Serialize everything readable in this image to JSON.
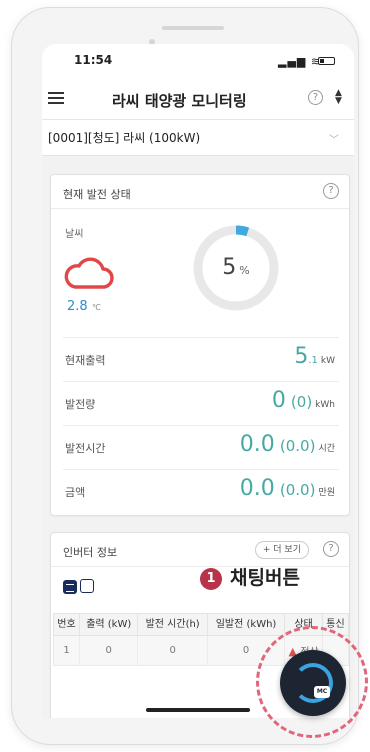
{
  "status_bar": {
    "time": "11:54"
  },
  "app": {
    "title": "라씨 태양광 모니터링",
    "help": "?",
    "sort_icon": "sort-icon"
  },
  "site_select": {
    "value": "[0001][청도] 라씨 (100kW)"
  },
  "current_status": {
    "title": "현재 발전 상태",
    "help": "?",
    "weather_label": "날씨",
    "weather_icon": "cloud-icon",
    "temperature": "2.8",
    "temperature_unit": "℃",
    "gauge_value": "5",
    "gauge_unit": "%",
    "gauge_fraction": 0.05,
    "rows": [
      {
        "label": "현재출력",
        "big": "5",
        "small": ".1",
        "paren": "",
        "unit": "kW"
      },
      {
        "label": "발전량",
        "big": "0",
        "small": "",
        "paren": "(0)",
        "unit": "kWh"
      },
      {
        "label": "발전시간",
        "big": "0.0",
        "small": "",
        "paren": "(0.0)",
        "unit": "시간"
      },
      {
        "label": "금액",
        "big": "0.0",
        "small": "",
        "paren": "(0.0)",
        "unit": "만원"
      }
    ]
  },
  "inverter": {
    "title": "인버터 정보",
    "more_label": "+ 더 보기",
    "help": "?",
    "columns": [
      "번호",
      "출력 (kW)",
      "발전 시간(h)",
      "일발전 (kWh)",
      "상태",
      "통신"
    ],
    "rows": [
      {
        "no": "1",
        "output": "0",
        "hours": "0",
        "daily": "0",
        "status": "정상",
        "comm": ""
      }
    ]
  },
  "annotation": {
    "number": "1",
    "text": "채팅버튼"
  },
  "chat_button": {
    "badge": "MC",
    "icon": "chat-icon"
  },
  "colors": {
    "accent": "#47a9a3",
    "weather": "#e04848",
    "gauge": "#3fa9e0",
    "annotation": "#b8324a"
  }
}
